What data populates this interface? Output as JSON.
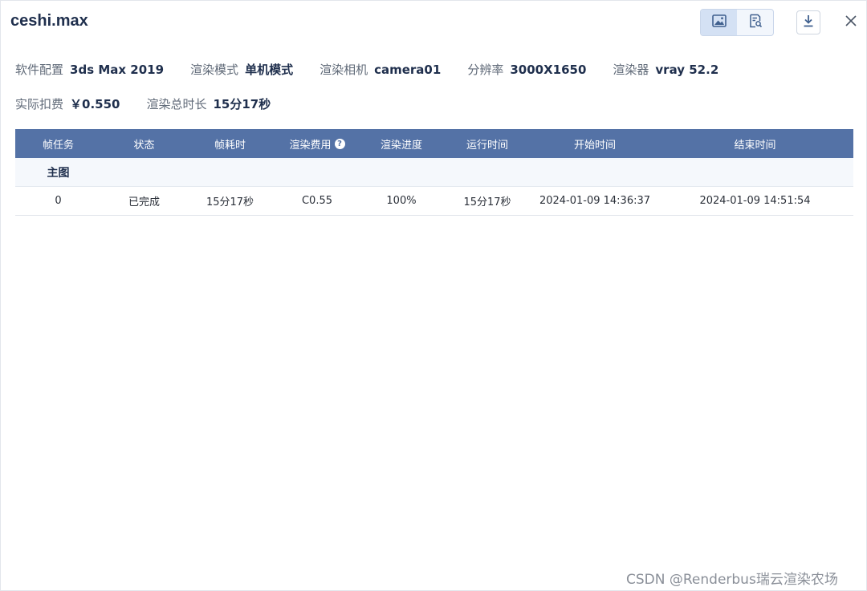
{
  "window": {
    "title": "ceshi.max"
  },
  "toolbar": {
    "image_view_icon": "image-icon",
    "log_view_icon": "document-search-icon",
    "download_icon": "download-icon",
    "close_icon": "close-icon"
  },
  "info": {
    "row1": [
      {
        "label": "软件配置",
        "value": "3ds Max 2019"
      },
      {
        "label": "渲染模式",
        "value": "单机模式"
      },
      {
        "label": "渲染相机",
        "value": "camera01"
      },
      {
        "label": "分辨率",
        "value": "3000X1650"
      },
      {
        "label": "渲染器",
        "value": "vray 52.2"
      }
    ],
    "row2": [
      {
        "label": "实际扣费",
        "value": "￥0.550"
      },
      {
        "label": "渲染总时长",
        "value": "15分17秒"
      }
    ]
  },
  "table": {
    "headers": [
      "帧任务",
      "状态",
      "帧耗时",
      "渲染费用",
      "渲染进度",
      "运行时间",
      "开始时间",
      "结束时间"
    ],
    "group_label": "主图",
    "rows": [
      [
        "0",
        "已完成",
        "15分17秒",
        "C0.55",
        "100%",
        "15分17秒",
        "2024-01-09 14:36:37",
        "2024-01-09 14:51:54"
      ]
    ]
  },
  "watermark": "CSDN @Renderbus瑞云渲染农场",
  "colors": {
    "header_bg": "#5472a6",
    "title": "#1f2f4d",
    "active_toolbar": "#d4e1f4"
  }
}
